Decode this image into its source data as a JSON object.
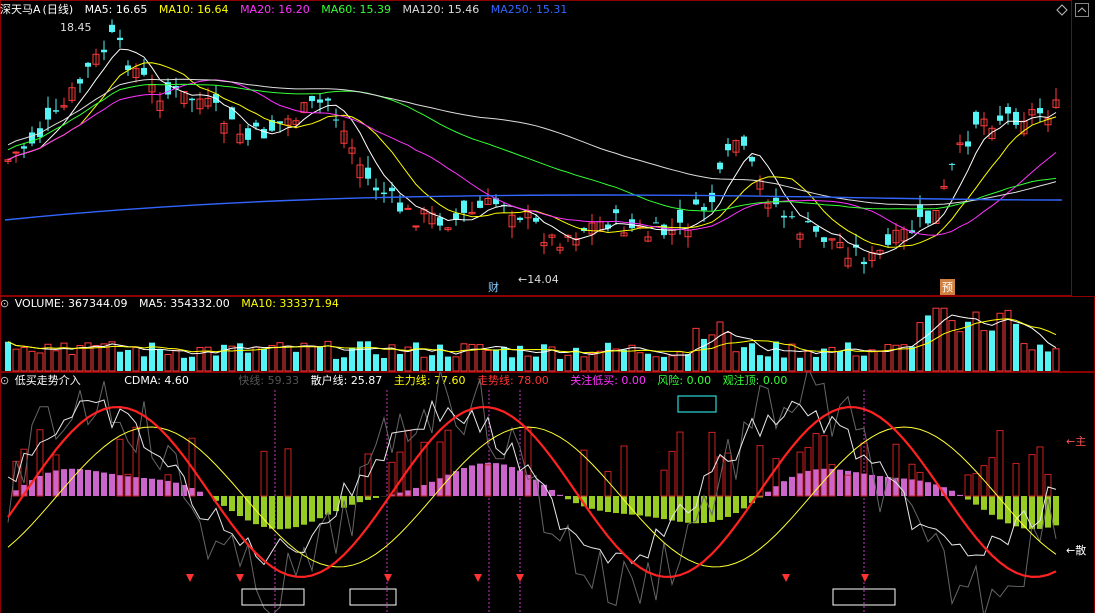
{
  "main_panel": {
    "stock_name": "深天马A",
    "period": "(日线)",
    "ma": [
      {
        "label": "MA5",
        "value": "16.65",
        "color": "#ffffff"
      },
      {
        "label": "MA10",
        "value": "16.64",
        "color": "#ffff00"
      },
      {
        "label": "MA20",
        "value": "16.20",
        "color": "#ff33ff"
      },
      {
        "label": "MA60",
        "value": "15.39",
        "color": "#33ff33"
      },
      {
        "label": "MA120",
        "value": "15.46",
        "color": "#dddddd"
      },
      {
        "label": "MA250",
        "value": "15.31",
        "color": "#3366ff"
      }
    ],
    "high_label": "18.45",
    "low_label": "←14.04",
    "marker_left": "财",
    "marker_right": "预"
  },
  "volume_panel": {
    "items": [
      {
        "label": "VOLUME",
        "value": "367344.09",
        "color": "#ffffff"
      },
      {
        "label": "MA5",
        "value": "354332.00",
        "color": "#ffffff"
      },
      {
        "label": "MA10",
        "value": "333371.94",
        "color": "#ffff00"
      }
    ]
  },
  "indicator_panel": {
    "title": "低买走势介入",
    "items": [
      {
        "label": "CDMA",
        "value": "4.60",
        "color": "#ffffff"
      },
      {
        "label": "快线",
        "value": "59.33",
        "color": "#555555"
      },
      {
        "label": "散户线",
        "value": "25.87",
        "color": "#ffffff"
      },
      {
        "label": "主力线",
        "value": "77.60",
        "color": "#ffff00"
      },
      {
        "label": "走势线",
        "value": "78.00",
        "color": "#ff3333"
      },
      {
        "label": "关注低买",
        "value": "0.00",
        "color": "#ff33ff"
      },
      {
        "label": "风险",
        "value": "0.00",
        "color": "#33ff33"
      },
      {
        "label": "观注顶",
        "value": "0.00",
        "color": "#33ff33"
      }
    ],
    "right_label_main": "←主",
    "right_label_retail": "←散"
  },
  "icons": {
    "toggle": "circle-arrow-icon",
    "diamond": "diamond-icon",
    "collapse": "chevron-up-icon"
  }
}
